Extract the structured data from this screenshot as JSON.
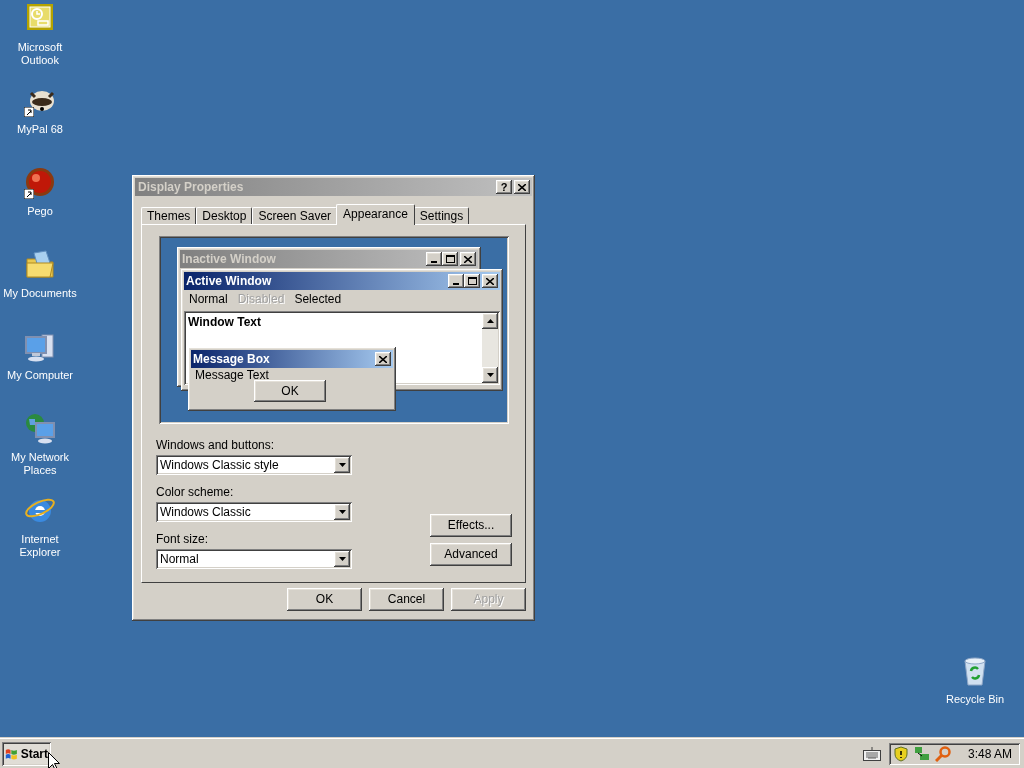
{
  "desktop_icons": [
    {
      "label": "Microsoft Outlook",
      "kind": "outlook",
      "shortcut": false
    },
    {
      "label": "MyPal 68",
      "kind": "raccoon",
      "shortcut": true
    },
    {
      "label": "Pego",
      "kind": "ball",
      "shortcut": true
    },
    {
      "label": "My Documents",
      "kind": "folder",
      "shortcut": false
    },
    {
      "label": "My Computer",
      "kind": "computer",
      "shortcut": false
    },
    {
      "label": "My Network Places",
      "kind": "network",
      "shortcut": false
    },
    {
      "label": "Internet Explorer",
      "kind": "browser",
      "shortcut": false
    }
  ],
  "recycle_bin": {
    "label": "Recycle Bin"
  },
  "dialog": {
    "title": "Display Properties",
    "help_button": "?",
    "tabs": [
      {
        "label": "Themes",
        "selected": false
      },
      {
        "label": "Desktop",
        "selected": false
      },
      {
        "label": "Screen Saver",
        "selected": false
      },
      {
        "label": "Appearance",
        "selected": true
      },
      {
        "label": "Settings",
        "selected": false
      }
    ],
    "preview": {
      "inactive_window": {
        "title": "Inactive Window"
      },
      "active_window": {
        "title": "Active Window",
        "window_text": "Window Text"
      },
      "menu_items": [
        {
          "label": "Normal",
          "disabled": false
        },
        {
          "label": "Disabled",
          "disabled": true
        },
        {
          "label": "Selected",
          "disabled": false
        }
      ],
      "message_box": {
        "title": "Message Box",
        "message_text": "Message Text",
        "button": "OK"
      }
    },
    "settings": [
      {
        "label": "Windows and buttons:",
        "value": "Windows Classic style"
      },
      {
        "label": "Color scheme:",
        "value": "Windows Classic"
      },
      {
        "label": "Font size:",
        "value": "Normal"
      }
    ],
    "side_buttons": [
      {
        "label": "Effects...",
        "disabled": false
      },
      {
        "label": "Advanced",
        "disabled": false
      }
    ],
    "buttons": [
      {
        "label": "OK",
        "disabled": false
      },
      {
        "label": "Cancel",
        "disabled": false
      },
      {
        "label": "Apply",
        "disabled": true
      }
    ]
  },
  "taskbar": {
    "start_label": "Start",
    "clock": "3:48 AM"
  }
}
